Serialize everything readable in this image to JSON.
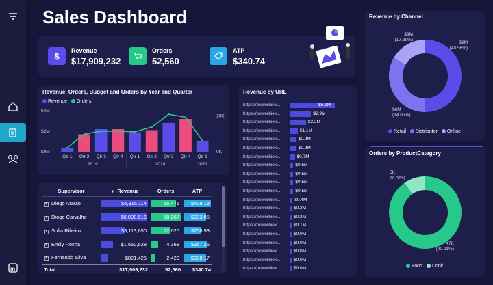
{
  "title": "Sales Dashboard",
  "kpis": [
    {
      "label": "Revenue",
      "value": "$17,909,232",
      "icon": "dollar-icon",
      "color": "#5a4ce8"
    },
    {
      "label": "Orders",
      "value": "52,560",
      "icon": "cart-icon",
      "color": "#27c98b"
    },
    {
      "label": "ATP",
      "value": "$340.74",
      "icon": "tag-icon",
      "color": "#2aa7e6"
    }
  ],
  "combo": {
    "title": "Revenue, Orders, Budget and Orders by Year and Quarter",
    "legend": [
      "Revenue",
      "Orders"
    ],
    "colors": {
      "revenue": "#5a4ce8",
      "orders": "#27c98b",
      "budget": "#ea4d7d"
    },
    "y_left_ticks": [
      "$4M",
      "$2M",
      "$0M"
    ],
    "y_right_ticks": [
      "10K",
      "0K"
    ],
    "quarters": [
      "Qtr 1",
      "Qtr 2",
      "Qtr 3",
      "Qtr 4",
      "Qtr 1",
      "Qtr 2",
      "Qtr 3",
      "Qtr 4",
      "Qtr 1"
    ],
    "years": [
      "2019",
      "2020",
      "2021"
    ]
  },
  "supervisor": {
    "headers": [
      "Supervisor",
      "Revenue",
      "Orders",
      "ATP"
    ],
    "rows": [
      {
        "name": "Diego Araujo",
        "revenue": "$6,315,114",
        "orders": "15,471",
        "atp": "$408.19"
      },
      {
        "name": "Diogo Carvalho",
        "revenue": "$6,098,516",
        "orders": "18,267",
        "atp": "$333.85"
      },
      {
        "name": "Sofia Ribeiro",
        "revenue": "$3,113,650",
        "orders": "12,025",
        "atp": "$258.93"
      },
      {
        "name": "Emily Rocha",
        "revenue": "$1,560,528",
        "orders": "4,368",
        "atp": "$357.26"
      },
      {
        "name": "Fernando Silva",
        "revenue": "$821,425",
        "orders": "2,429",
        "atp": "$338.17"
      }
    ],
    "total": {
      "label": "Total",
      "revenue": "$17,909,232",
      "orders": "52,560",
      "atp": "$340.74"
    }
  },
  "url": {
    "title": "Revenue by URL",
    "rows": [
      {
        "label": "https://powerbiex...",
        "value": "$6.1M",
        "v": 6.1
      },
      {
        "label": "https://powerbiex...",
        "value": "$2.9M",
        "v": 2.9
      },
      {
        "label": "https://powerbiex...",
        "value": "$2.2M",
        "v": 2.2
      },
      {
        "label": "https://powerbiex...",
        "value": "$1.1M",
        "v": 1.1
      },
      {
        "label": "https://powerbiex...",
        "value": "$0.9M",
        "v": 0.9
      },
      {
        "label": "https://powerbiex...",
        "value": "$0.9M",
        "v": 0.9
      },
      {
        "label": "https://powerbiex...",
        "value": "$0.7M",
        "v": 0.7
      },
      {
        "label": "https://powerbiex...",
        "value": "$0.5M",
        "v": 0.5
      },
      {
        "label": "https://powerbiex...",
        "value": "$0.5M",
        "v": 0.5
      },
      {
        "label": "https://powerbiex...",
        "value": "$0.5M",
        "v": 0.5
      },
      {
        "label": "https://powerbiex...",
        "value": "$0.5M",
        "v": 0.5
      },
      {
        "label": "https://powerbiex...",
        "value": "$0.4M",
        "v": 0.4
      },
      {
        "label": "https://powerbiex...",
        "value": "$0.2M",
        "v": 0.2
      },
      {
        "label": "https://powerbiex...",
        "value": "$0.2M",
        "v": 0.2
      },
      {
        "label": "https://powerbiex...",
        "value": "$0.1M",
        "v": 0.1
      },
      {
        "label": "https://powerbiex...",
        "value": "$0.0M",
        "v": 0.04
      },
      {
        "label": "https://powerbiex...",
        "value": "$0.0M",
        "v": 0.03
      },
      {
        "label": "https://powerbiex...",
        "value": "$0.0M",
        "v": 0.03
      },
      {
        "label": "https://powerbiex...",
        "value": "$0.0M",
        "v": 0.02
      },
      {
        "label": "https://powerbiex...",
        "value": "$0.0M",
        "v": 0.02
      }
    ]
  },
  "channel": {
    "title": "Revenue by Channel",
    "slices": [
      {
        "name": "Retail",
        "value": 9,
        "label": "$9M",
        "pct": "(48.56%)",
        "color": "#5a4ce8"
      },
      {
        "name": "Distributor",
        "value": 6,
        "label": "$6M",
        "pct": "(34.05%)",
        "color": "#7d72f0"
      },
      {
        "name": "Online",
        "value": 3,
        "label": "$3M",
        "pct": "(17.39%)",
        "color": "#a9a2f5"
      }
    ]
  },
  "category": {
    "title": "Orders by ProductCategory",
    "slices": [
      {
        "name": "Food",
        "value": 47,
        "label": "47K",
        "pct": "(90.21%)",
        "color": "#27c98b"
      },
      {
        "name": "Drink",
        "value": 5,
        "label": "5K",
        "pct": "(9.79%)",
        "color": "#8fe6c5"
      }
    ]
  },
  "chart_data": {
    "type": "bar",
    "title": "Revenue, Orders, Budget and Orders by Year and Quarter",
    "categories": [
      "2019 Qtr 1",
      "2019 Qtr 2",
      "2019 Qtr 3",
      "2019 Qtr 4",
      "2020 Qtr 1",
      "2020 Qtr 2",
      "2020 Qtr 3",
      "2020 Qtr 4",
      "2021 Qtr 1"
    ],
    "series": [
      {
        "name": "Revenue",
        "values": [
          0.4,
          1.7,
          2.2,
          2.2,
          1.9,
          2.1,
          2.8,
          3.2,
          1.0
        ]
      },
      {
        "name": "Orders",
        "values": [
          0.7,
          3.0,
          3.5,
          3.5,
          3.4,
          4.2,
          6.4,
          5.9,
          1.9
        ]
      }
    ],
    "ylim": [
      0,
      4
    ]
  }
}
